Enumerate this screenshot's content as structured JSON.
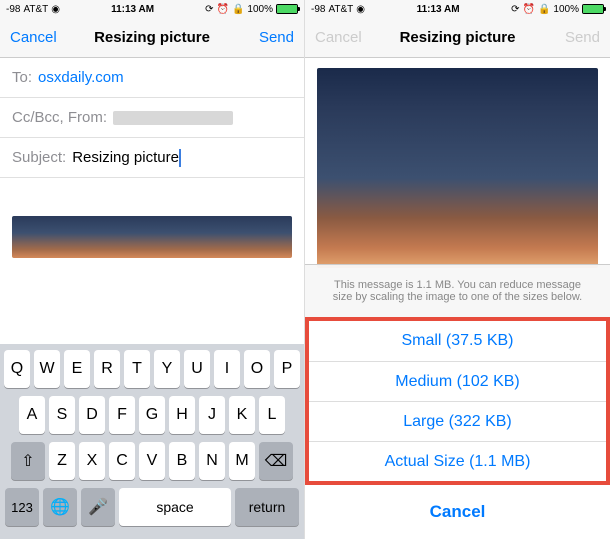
{
  "status": {
    "signal": "-98",
    "carrier": "AT&T",
    "wifi": "●",
    "time": "11:13 AM",
    "orientation_lock": true,
    "alarm": true,
    "battery_pct": "100%"
  },
  "left": {
    "nav": {
      "cancel": "Cancel",
      "title": "Resizing picture",
      "send": "Send"
    },
    "fields": {
      "to_label": "To:",
      "to_value": "osxdaily.com",
      "ccbcc_label": "Cc/Bcc, From:",
      "subject_label": "Subject:",
      "subject_value": "Resizing picture"
    },
    "keyboard": {
      "row1": [
        "Q",
        "W",
        "E",
        "R",
        "T",
        "Y",
        "U",
        "I",
        "O",
        "P"
      ],
      "row2": [
        "A",
        "S",
        "D",
        "F",
        "G",
        "H",
        "J",
        "K",
        "L"
      ],
      "row3": [
        "Z",
        "X",
        "C",
        "V",
        "B",
        "N",
        "M"
      ],
      "shift": "⇧",
      "backspace": "⌫",
      "numkey": "123",
      "globe": "🌐",
      "mic": "🎤",
      "space": "space",
      "return": "return"
    }
  },
  "right": {
    "nav": {
      "cancel": "Cancel",
      "title": "Resizing picture",
      "send": "Send"
    },
    "sheet": {
      "info": "This message is 1.1 MB. You can reduce message size by scaling the image to one of the sizes below.",
      "options": [
        {
          "label": "Small (37.5 KB)"
        },
        {
          "label": "Medium (102 KB)"
        },
        {
          "label": "Large (322 KB)"
        },
        {
          "label": "Actual Size (1.1 MB)"
        }
      ],
      "cancel": "Cancel"
    }
  }
}
